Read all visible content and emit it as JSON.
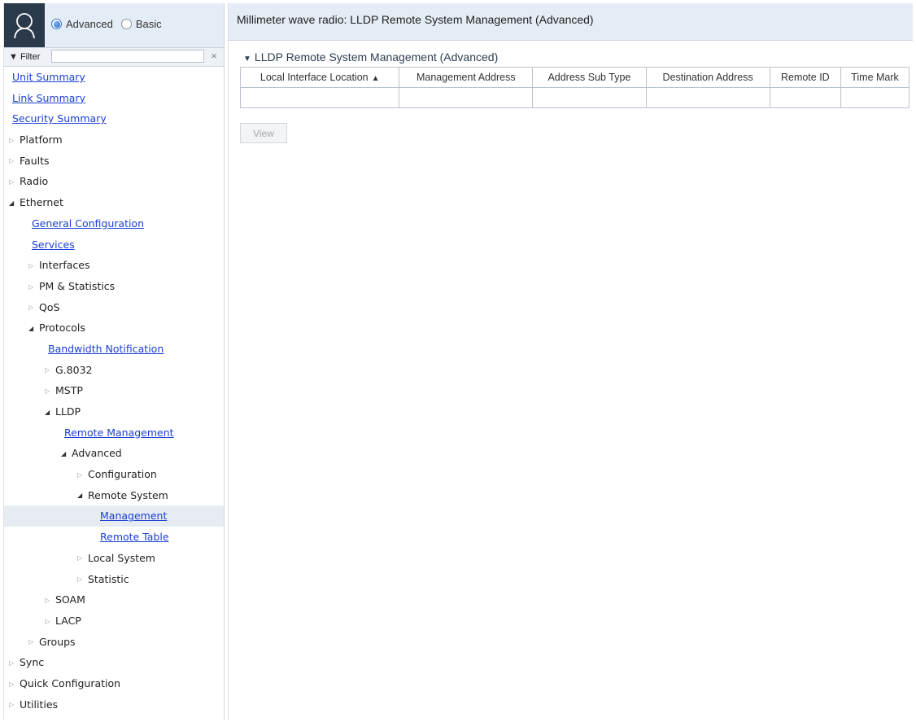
{
  "app": {
    "window_title": "Millimeter wave radio: LLDP Remote System Management (Advanced)"
  },
  "sidebar": {
    "mode": {
      "options": [
        "Advanced",
        "Basic"
      ],
      "selected": "Advanced"
    },
    "filter": {
      "label": "▼ Filter",
      "value": "",
      "clear_glyph": "×"
    },
    "nav": [
      {
        "label": "Unit Summary",
        "level": 0,
        "type": "link"
      },
      {
        "label": "Link Summary",
        "level": 0,
        "type": "link"
      },
      {
        "label": "Security Summary",
        "level": 0,
        "type": "link"
      },
      {
        "label": "Platform",
        "level": 0,
        "type": "collapsed"
      },
      {
        "label": "Faults",
        "level": 0,
        "type": "collapsed"
      },
      {
        "label": "Radio",
        "level": 0,
        "type": "collapsed"
      },
      {
        "label": "Ethernet",
        "level": 0,
        "type": "expanded"
      },
      {
        "label": "General Configuration",
        "level": 1,
        "type": "link"
      },
      {
        "label": "Services",
        "level": 1,
        "type": "link"
      },
      {
        "label": "Interfaces",
        "level": 1,
        "type": "collapsed"
      },
      {
        "label": "PM & Statistics",
        "level": 1,
        "type": "collapsed"
      },
      {
        "label": "QoS",
        "level": 1,
        "type": "collapsed"
      },
      {
        "label": "Protocols",
        "level": 1,
        "type": "expanded"
      },
      {
        "label": "Bandwidth Notification",
        "level": 2,
        "type": "link"
      },
      {
        "label": "G.8032",
        "level": 2,
        "type": "collapsed"
      },
      {
        "label": "MSTP",
        "level": 2,
        "type": "collapsed"
      },
      {
        "label": "LLDP",
        "level": 2,
        "type": "expanded"
      },
      {
        "label": "Remote Management",
        "level": 3,
        "type": "link"
      },
      {
        "label": "Advanced",
        "level": 3,
        "type": "expanded"
      },
      {
        "label": "Configuration",
        "level": 4,
        "type": "collapsed"
      },
      {
        "label": "Remote System",
        "level": 4,
        "type": "expanded"
      },
      {
        "label": "Management",
        "level": 5,
        "type": "link",
        "selected": true
      },
      {
        "label": "Remote Table",
        "level": 5,
        "type": "link"
      },
      {
        "label": "Local System",
        "level": 4,
        "type": "collapsed"
      },
      {
        "label": "Statistic",
        "level": 4,
        "type": "collapsed"
      },
      {
        "label": "SOAM",
        "level": 2,
        "type": "collapsed"
      },
      {
        "label": "LACP",
        "level": 2,
        "type": "collapsed"
      },
      {
        "label": "Groups",
        "level": 1,
        "type": "collapsed"
      },
      {
        "label": "Sync",
        "level": 0,
        "type": "collapsed"
      },
      {
        "label": "Quick Configuration",
        "level": 0,
        "type": "collapsed"
      },
      {
        "label": "Utilities",
        "level": 0,
        "type": "collapsed"
      }
    ]
  },
  "main": {
    "panel_title": "LLDP Remote System Management (Advanced)",
    "panel_caret": "▼",
    "table": {
      "columns": [
        {
          "label": "Local Interface Location",
          "sort": "▲"
        },
        {
          "label": "Management Address"
        },
        {
          "label": "Address Sub Type"
        },
        {
          "label": "Destination Address"
        },
        {
          "label": "Remote ID"
        },
        {
          "label": "Time Mark"
        }
      ],
      "rows": [
        [
          "",
          "",
          "",
          "",
          "",
          ""
        ]
      ]
    },
    "view_button": "View"
  },
  "colors": {
    "header_bg": "#e4ecf5",
    "link": "#1a3fd4",
    "selected_row": "#e7ecf2",
    "user_box": "#2b3a4a"
  }
}
